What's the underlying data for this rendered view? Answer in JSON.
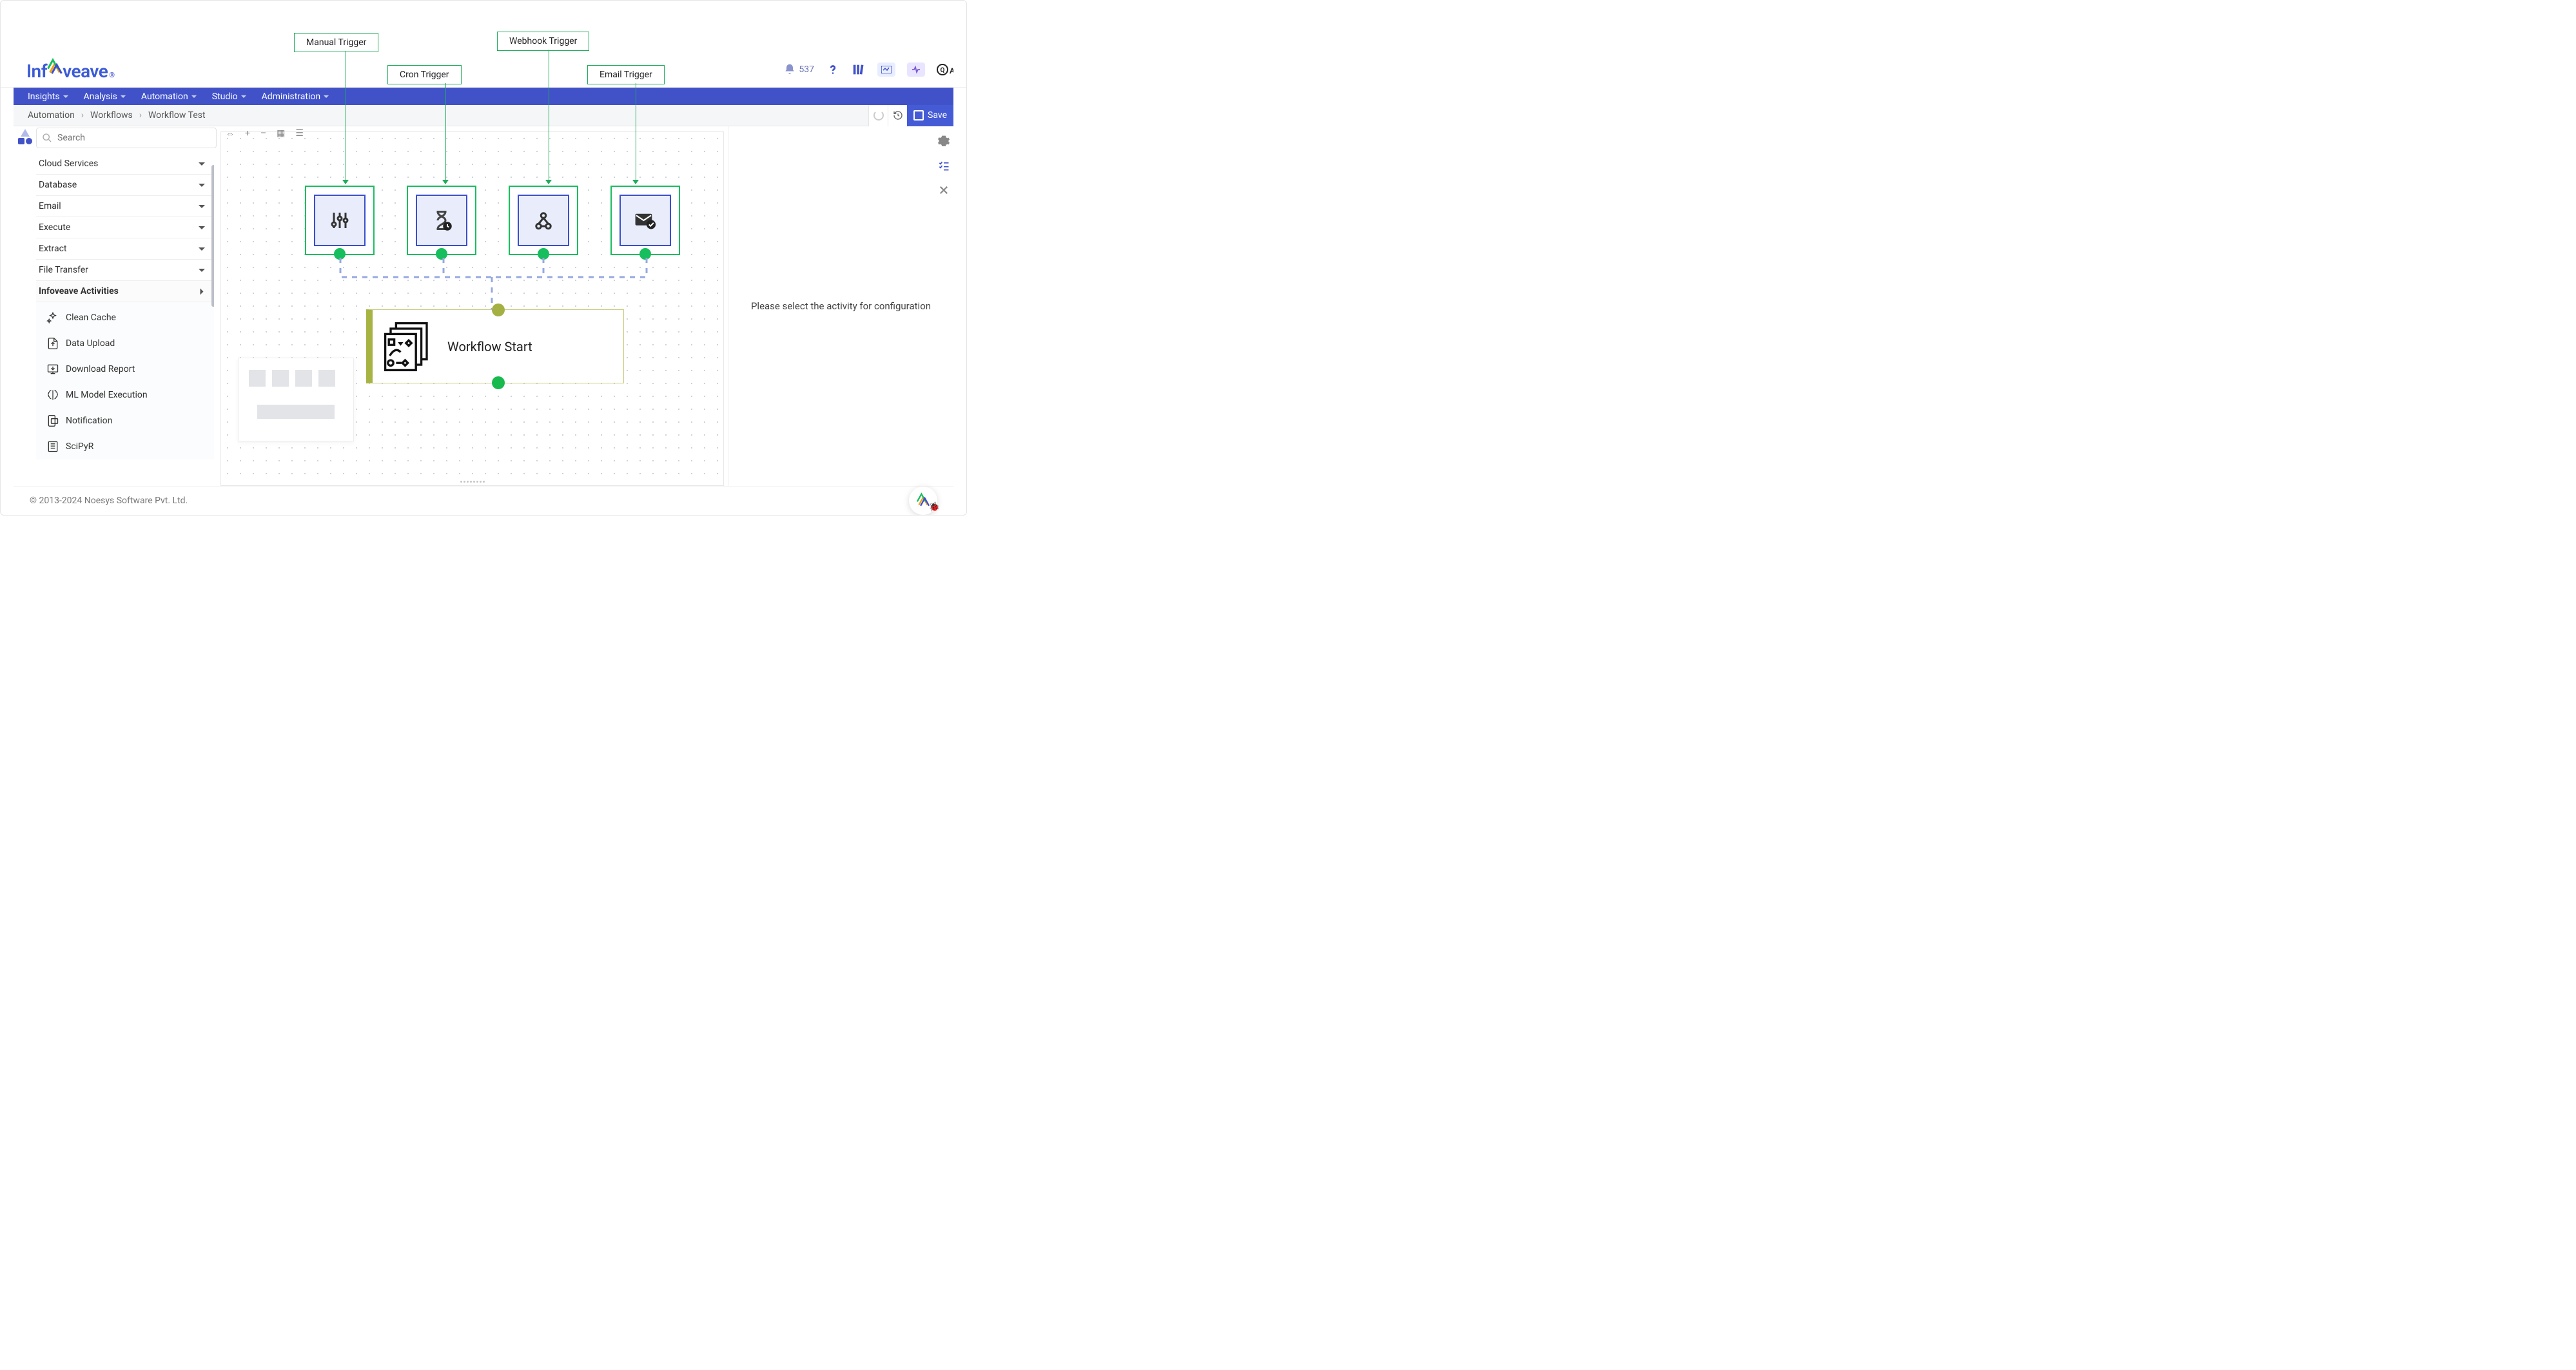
{
  "callouts": {
    "manual": "Manual Trigger",
    "cron": "Cron Trigger",
    "webhook": "Webhook Trigger",
    "email": "Email Trigger"
  },
  "logo": {
    "part1": "Inf",
    "part2": "veave"
  },
  "notifications_count": "537",
  "nav": {
    "items": [
      "Insights",
      "Analysis",
      "Automation",
      "Studio",
      "Administration"
    ]
  },
  "breadcrumb": {
    "items": [
      "Automation",
      "Workflows",
      "Workflow Test"
    ]
  },
  "actions": {
    "save": "Save"
  },
  "search": {
    "placeholder": "Search"
  },
  "palette": {
    "categories": [
      {
        "label": "Cloud Services"
      },
      {
        "label": "Database"
      },
      {
        "label": "Email"
      },
      {
        "label": "Execute"
      },
      {
        "label": "Extract"
      },
      {
        "label": "File Transfer"
      }
    ],
    "active_category": "Infoveave Activities",
    "activities": [
      "Clean Cache",
      "Data Upload",
      "Download Report",
      "ML Model Execution",
      "Notification",
      "SciPyR"
    ]
  },
  "canvas": {
    "toolbar_plus": "+",
    "toolbar_minus": "–",
    "workflow_start_label": "Workflow Start"
  },
  "right_panel": {
    "placeholder": "Please select the activity for configuration"
  },
  "footer": {
    "copyright": "© 2013-2024 Noesys Software Pvt. Ltd."
  }
}
